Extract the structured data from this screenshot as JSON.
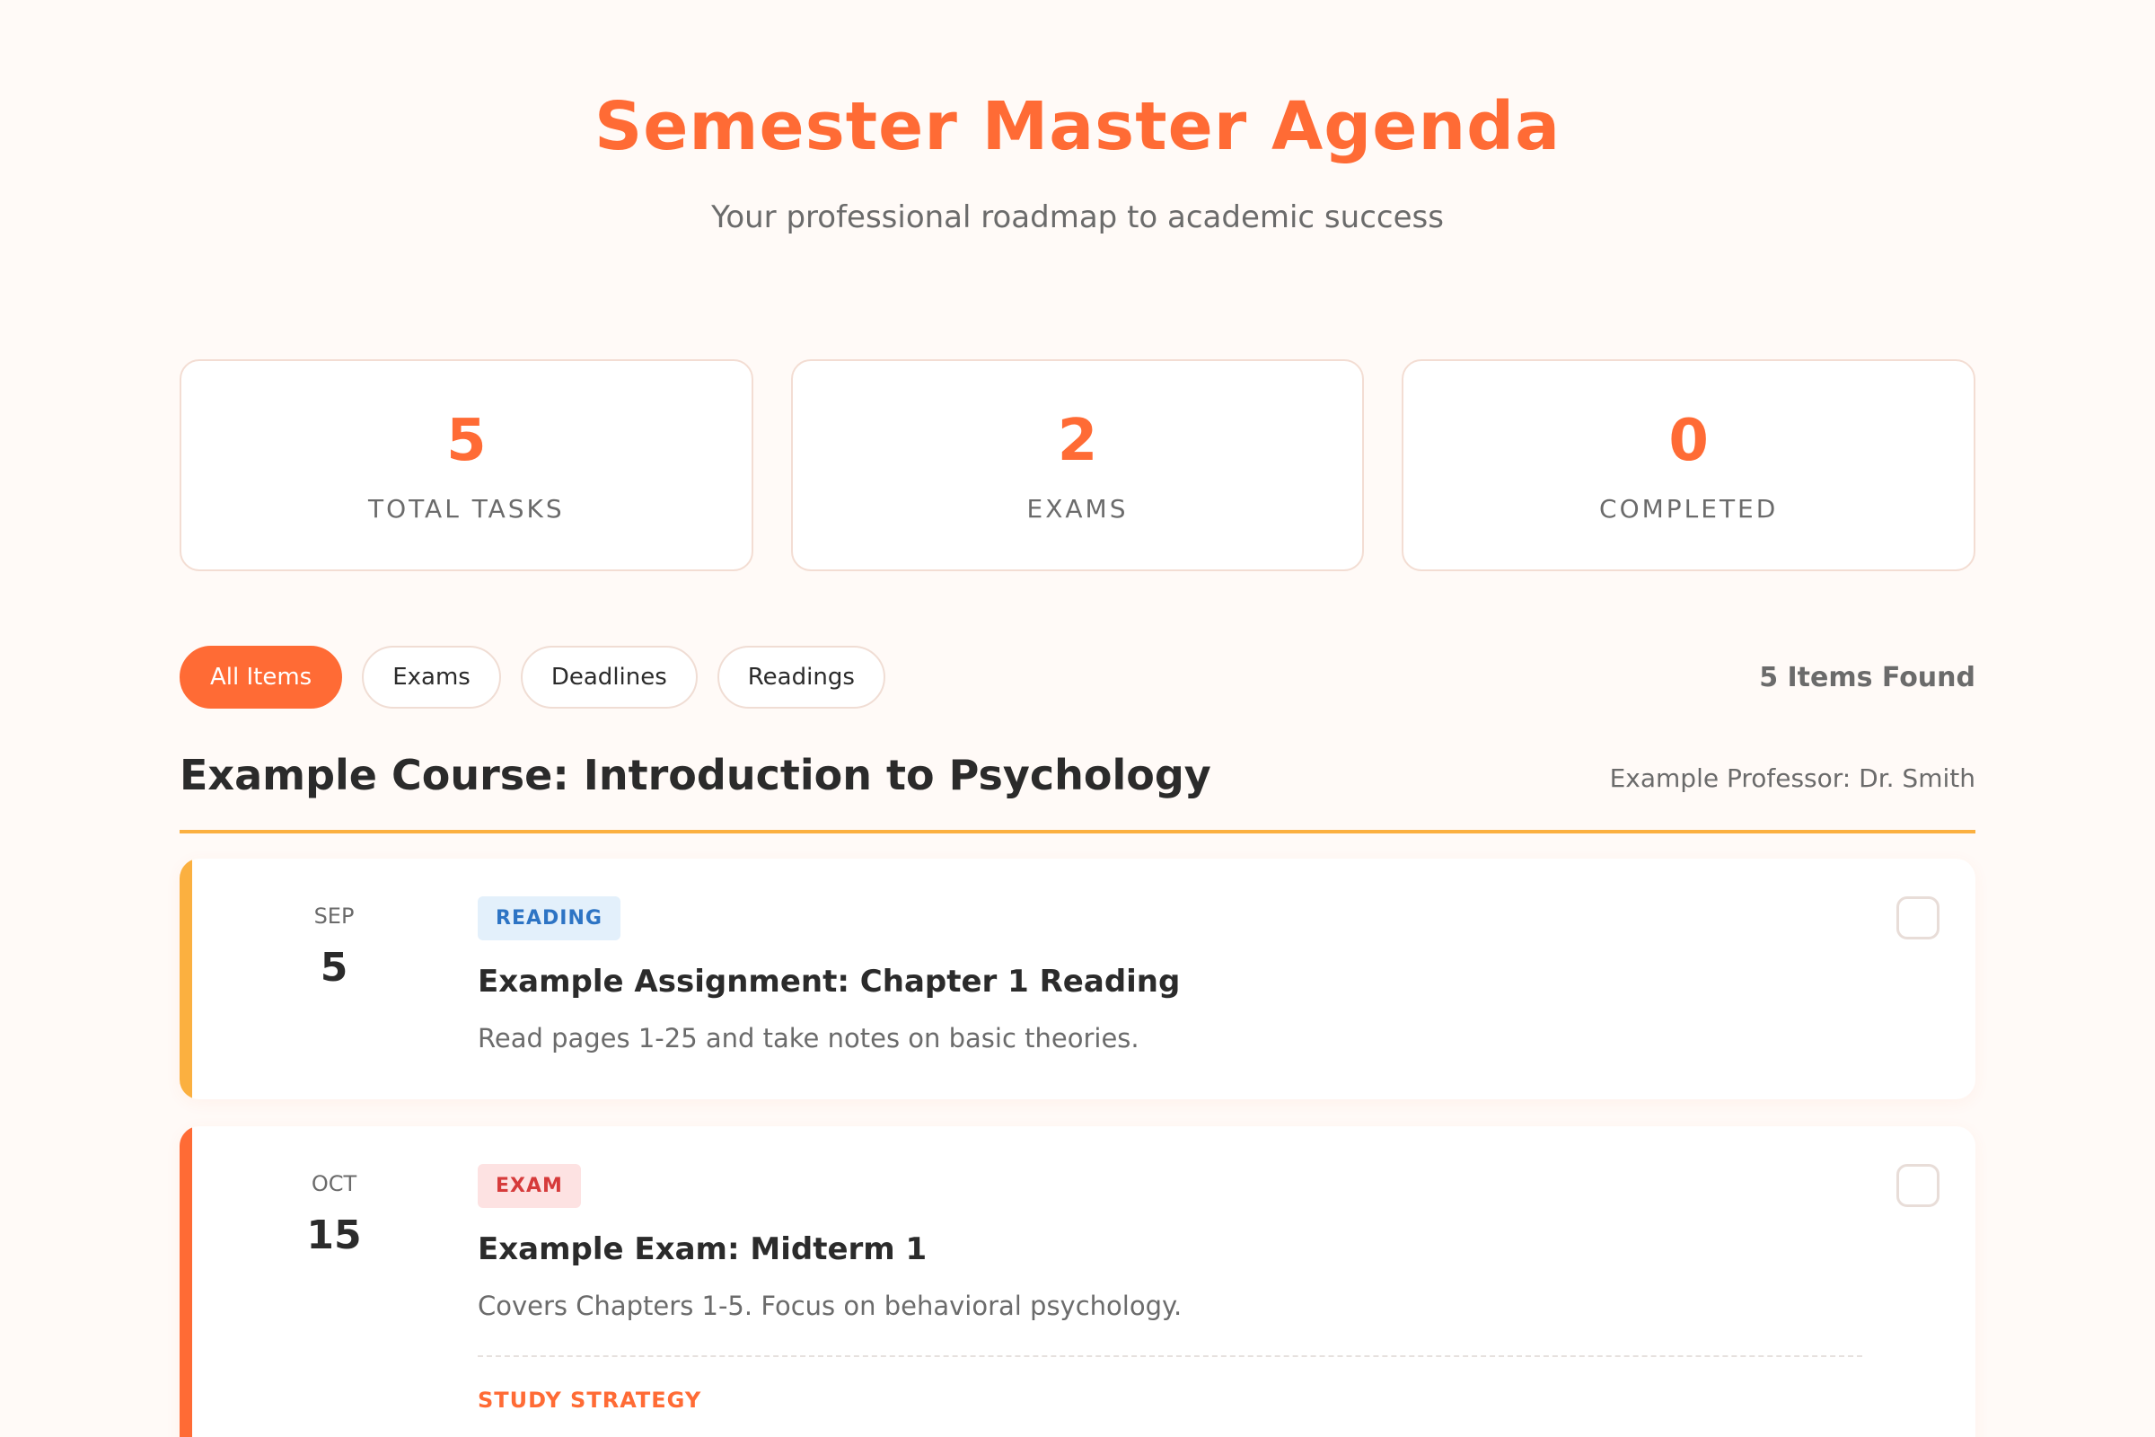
{
  "header": {
    "title": "Semester Master Agenda",
    "subtitle": "Your professional roadmap to academic success"
  },
  "stats": [
    {
      "value": "5",
      "label": "TOTAL TASKS"
    },
    {
      "value": "2",
      "label": "EXAMS"
    },
    {
      "value": "0",
      "label": "COMPLETED"
    }
  ],
  "filters": {
    "all": "All Items",
    "exams": "Exams",
    "deadlines": "Deadlines",
    "readings": "Readings",
    "active": "All Items",
    "count_text": "5 Items Found"
  },
  "course": {
    "title": "Example Course: Introduction to Psychology",
    "professor": "Example Professor: Dr. Smith"
  },
  "items": [
    {
      "month": "SEP",
      "day": "5",
      "badge": "READING",
      "title": "Example Assignment: Chapter 1 Reading",
      "description": "Read pages 1-25 and take notes on basic theories.",
      "accent_color": "#fbb040"
    },
    {
      "month": "OCT",
      "day": "15",
      "badge": "EXAM",
      "title": "Example Exam: Midterm 1",
      "description": "Covers Chapters 1-5. Focus on behavioral psychology.",
      "strategy_label": "STUDY STRATEGY",
      "accent_color": "#ff6b35"
    }
  ],
  "colors": {
    "accent": "#ff6b35",
    "background": "#fffaf7",
    "course_underline": "#fbb040"
  }
}
